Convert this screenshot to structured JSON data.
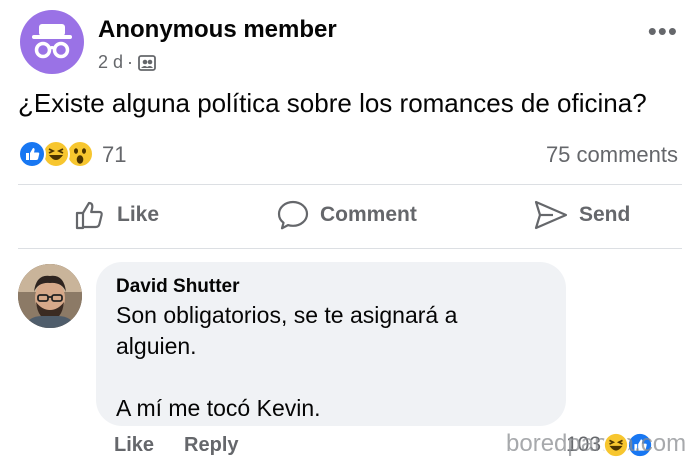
{
  "post": {
    "author": "Anonymous member",
    "time": "2 d",
    "separator": "·",
    "text": "¿Existe alguna política sobre los romances de oficina?",
    "more_icon": "more-horizontal-icon",
    "reaction_count": "71",
    "comments_count": "75 comments",
    "reactions": [
      "like",
      "haha",
      "wow"
    ]
  },
  "actions": {
    "like": "Like",
    "comment": "Comment",
    "send": "Send"
  },
  "comment": {
    "author": "David Shutter",
    "line1": "Son obligatorios, se te asignará a",
    "line2": "alguien.",
    "line3": "A mí me tocó Kevin.",
    "like_label": "Like",
    "reply_label": "Reply",
    "reaction_count": "103"
  },
  "watermark": "boredpanda.com",
  "colors": {
    "facebook_blue": "#1877f2",
    "anon_purple": "#9a72e6",
    "gray_text": "#65676b",
    "bubble_bg": "#f0f2f5",
    "reaction_yellow": "#f7c62f"
  }
}
